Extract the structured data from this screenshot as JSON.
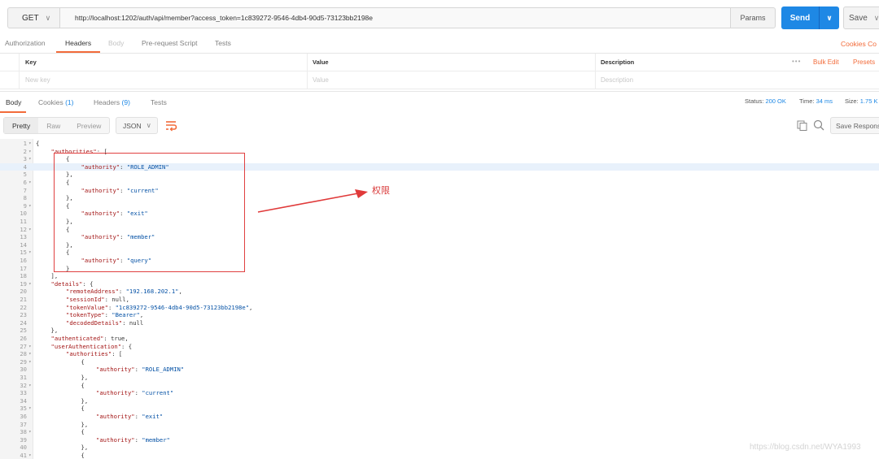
{
  "request": {
    "method": "GET",
    "url": "http://localhost:1202/auth/api/member?access_token=1c839272-9546-4db4-90d5-73123bb2198e",
    "params_label": "Params",
    "send_label": "Send",
    "save_label": "Save"
  },
  "request_tabs": {
    "authorization": "Authorization",
    "headers": "Headers",
    "body": "Body",
    "prerequest": "Pre-request Script",
    "tests": "Tests",
    "cookies": "Cookies  Co"
  },
  "headers_table": {
    "col_key": "Key",
    "col_value": "Value",
    "col_description": "Description",
    "more": "•••",
    "bulk_edit": "Bulk Edit",
    "presets": "Presets",
    "placeholder_key": "New key",
    "placeholder_value": "Value",
    "placeholder_description": "Description"
  },
  "response_tabs": {
    "body": "Body",
    "cookies": "Cookies",
    "cookies_count": "(1)",
    "headers": "Headers",
    "headers_count": "(9)",
    "tests": "Tests"
  },
  "response_status": {
    "status_label": "Status:",
    "status_value": "200 OK",
    "time_label": "Time:",
    "time_value": "34 ms",
    "size_label": "Size:",
    "size_value": "1.75 K"
  },
  "response_toolbar": {
    "pretty": "Pretty",
    "raw": "Raw",
    "preview": "Preview",
    "format": "JSON",
    "save_response": "Save Response"
  },
  "annotation": {
    "label": "权限"
  },
  "watermark": "https://blog.csdn.net/WYA1993",
  "code_lines": [
    {
      "n": "1",
      "fold": true,
      "indent": 0,
      "parts": [
        [
          "p",
          "{"
        ]
      ]
    },
    {
      "n": "2",
      "fold": true,
      "indent": 1,
      "parts": [
        [
          "k",
          "\"authorities\""
        ],
        [
          "p",
          ": ["
        ]
      ]
    },
    {
      "n": "3",
      "fold": true,
      "indent": 2,
      "parts": [
        [
          "p",
          "{"
        ]
      ]
    },
    {
      "n": "4",
      "fold": false,
      "indent": 3,
      "hl": true,
      "parts": [
        [
          "k",
          "\"authority\""
        ],
        [
          "p",
          ": "
        ],
        [
          "s",
          "\"ROLE_ADMIN\""
        ]
      ]
    },
    {
      "n": "5",
      "fold": false,
      "indent": 2,
      "parts": [
        [
          "p",
          "},"
        ]
      ]
    },
    {
      "n": "6",
      "fold": true,
      "indent": 2,
      "parts": [
        [
          "p",
          "{"
        ]
      ]
    },
    {
      "n": "7",
      "fold": false,
      "indent": 3,
      "parts": [
        [
          "k",
          "\"authority\""
        ],
        [
          "p",
          ": "
        ],
        [
          "s",
          "\"current\""
        ]
      ]
    },
    {
      "n": "8",
      "fold": false,
      "indent": 2,
      "parts": [
        [
          "p",
          "},"
        ]
      ]
    },
    {
      "n": "9",
      "fold": true,
      "indent": 2,
      "parts": [
        [
          "p",
          "{"
        ]
      ]
    },
    {
      "n": "10",
      "fold": false,
      "indent": 3,
      "parts": [
        [
          "k",
          "\"authority\""
        ],
        [
          "p",
          ": "
        ],
        [
          "s",
          "\"exit\""
        ]
      ]
    },
    {
      "n": "11",
      "fold": false,
      "indent": 2,
      "parts": [
        [
          "p",
          "},"
        ]
      ]
    },
    {
      "n": "12",
      "fold": true,
      "indent": 2,
      "parts": [
        [
          "p",
          "{"
        ]
      ]
    },
    {
      "n": "13",
      "fold": false,
      "indent": 3,
      "parts": [
        [
          "k",
          "\"authority\""
        ],
        [
          "p",
          ": "
        ],
        [
          "s",
          "\"member\""
        ]
      ]
    },
    {
      "n": "14",
      "fold": false,
      "indent": 2,
      "parts": [
        [
          "p",
          "},"
        ]
      ]
    },
    {
      "n": "15",
      "fold": true,
      "indent": 2,
      "parts": [
        [
          "p",
          "{"
        ]
      ]
    },
    {
      "n": "16",
      "fold": false,
      "indent": 3,
      "parts": [
        [
          "k",
          "\"authority\""
        ],
        [
          "p",
          ": "
        ],
        [
          "s",
          "\"query\""
        ]
      ]
    },
    {
      "n": "17",
      "fold": false,
      "indent": 2,
      "parts": [
        [
          "p",
          "}"
        ]
      ]
    },
    {
      "n": "18",
      "fold": false,
      "indent": 1,
      "parts": [
        [
          "p",
          "],"
        ]
      ]
    },
    {
      "n": "19",
      "fold": true,
      "indent": 1,
      "parts": [
        [
          "k",
          "\"details\""
        ],
        [
          "p",
          ": {"
        ]
      ]
    },
    {
      "n": "20",
      "fold": false,
      "indent": 2,
      "parts": [
        [
          "k",
          "\"remoteAddress\""
        ],
        [
          "p",
          ": "
        ],
        [
          "s",
          "\"192.168.202.1\""
        ],
        [
          "p",
          ","
        ]
      ]
    },
    {
      "n": "21",
      "fold": false,
      "indent": 2,
      "parts": [
        [
          "k",
          "\"sessionId\""
        ],
        [
          "p",
          ": null,"
        ]
      ]
    },
    {
      "n": "22",
      "fold": false,
      "indent": 2,
      "parts": [
        [
          "k",
          "\"tokenValue\""
        ],
        [
          "p",
          ": "
        ],
        [
          "s",
          "\"1c839272-9546-4db4-90d5-73123bb2198e\""
        ],
        [
          "p",
          ","
        ]
      ]
    },
    {
      "n": "23",
      "fold": false,
      "indent": 2,
      "parts": [
        [
          "k",
          "\"tokenType\""
        ],
        [
          "p",
          ": "
        ],
        [
          "s",
          "\"Bearer\""
        ],
        [
          "p",
          ","
        ]
      ]
    },
    {
      "n": "24",
      "fold": false,
      "indent": 2,
      "parts": [
        [
          "k",
          "\"decodedDetails\""
        ],
        [
          "p",
          ": null"
        ]
      ]
    },
    {
      "n": "25",
      "fold": false,
      "indent": 1,
      "parts": [
        [
          "p",
          "},"
        ]
      ]
    },
    {
      "n": "26",
      "fold": false,
      "indent": 1,
      "parts": [
        [
          "k",
          "\"authenticated\""
        ],
        [
          "p",
          ": true,"
        ]
      ]
    },
    {
      "n": "27",
      "fold": true,
      "indent": 1,
      "parts": [
        [
          "k",
          "\"userAuthentication\""
        ],
        [
          "p",
          ": {"
        ]
      ]
    },
    {
      "n": "28",
      "fold": true,
      "indent": 2,
      "parts": [
        [
          "k",
          "\"authorities\""
        ],
        [
          "p",
          ": ["
        ]
      ]
    },
    {
      "n": "29",
      "fold": true,
      "indent": 3,
      "parts": [
        [
          "p",
          "{"
        ]
      ]
    },
    {
      "n": "30",
      "fold": false,
      "indent": 4,
      "parts": [
        [
          "k",
          "\"authority\""
        ],
        [
          "p",
          ": "
        ],
        [
          "s",
          "\"ROLE_ADMIN\""
        ]
      ]
    },
    {
      "n": "31",
      "fold": false,
      "indent": 3,
      "parts": [
        [
          "p",
          "},"
        ]
      ]
    },
    {
      "n": "32",
      "fold": true,
      "indent": 3,
      "parts": [
        [
          "p",
          "{"
        ]
      ]
    },
    {
      "n": "33",
      "fold": false,
      "indent": 4,
      "parts": [
        [
          "k",
          "\"authority\""
        ],
        [
          "p",
          ": "
        ],
        [
          "s",
          "\"current\""
        ]
      ]
    },
    {
      "n": "34",
      "fold": false,
      "indent": 3,
      "parts": [
        [
          "p",
          "},"
        ]
      ]
    },
    {
      "n": "35",
      "fold": true,
      "indent": 3,
      "parts": [
        [
          "p",
          "{"
        ]
      ]
    },
    {
      "n": "36",
      "fold": false,
      "indent": 4,
      "parts": [
        [
          "k",
          "\"authority\""
        ],
        [
          "p",
          ": "
        ],
        [
          "s",
          "\"exit\""
        ]
      ]
    },
    {
      "n": "37",
      "fold": false,
      "indent": 3,
      "parts": [
        [
          "p",
          "},"
        ]
      ]
    },
    {
      "n": "38",
      "fold": true,
      "indent": 3,
      "parts": [
        [
          "p",
          "{"
        ]
      ]
    },
    {
      "n": "39",
      "fold": false,
      "indent": 4,
      "parts": [
        [
          "k",
          "\"authority\""
        ],
        [
          "p",
          ": "
        ],
        [
          "s",
          "\"member\""
        ]
      ]
    },
    {
      "n": "40",
      "fold": false,
      "indent": 3,
      "parts": [
        [
          "p",
          "},"
        ]
      ]
    },
    {
      "n": "41",
      "fold": true,
      "indent": 3,
      "parts": [
        [
          "p",
          "{"
        ]
      ]
    }
  ]
}
